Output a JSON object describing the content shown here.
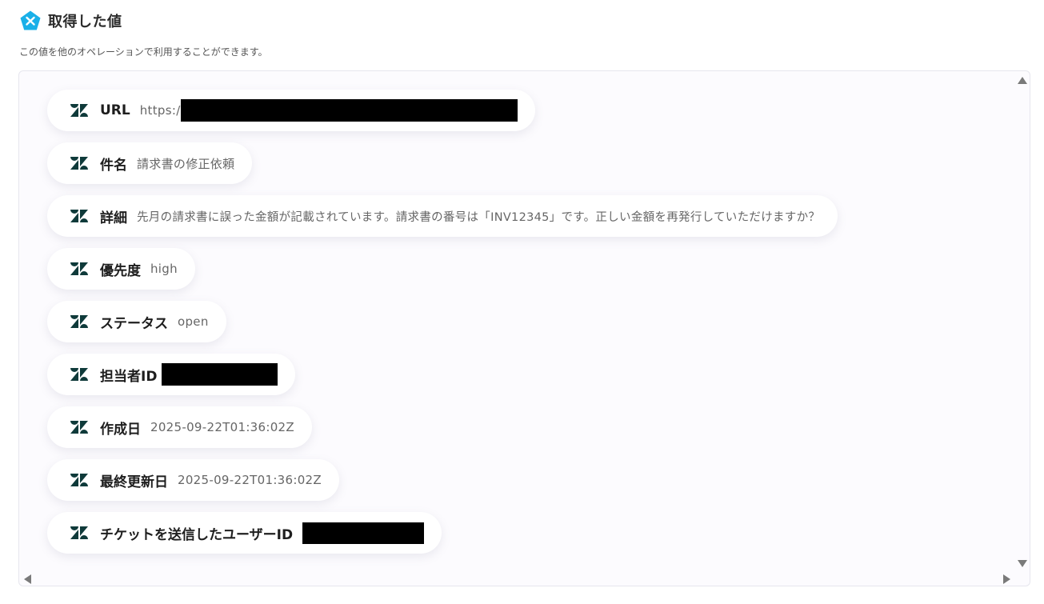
{
  "header": {
    "title": "取得した値",
    "subtitle": "この値を他のオペレーションで利用することができます。",
    "logo_icon": "yoom-pentagon-x-icon",
    "accent": "#1ab0e8"
  },
  "rows": [
    {
      "label": "URL",
      "value": "https:/",
      "redacted": true,
      "icon": "zendesk-icon"
    },
    {
      "label": "件名",
      "value": "請求書の修正依頼",
      "redacted": false,
      "icon": "zendesk-icon"
    },
    {
      "label": "詳細",
      "value": "先月の請求書に誤った金額が記載されています。請求書の番号は「INV12345」です。正しい金額を再発行していただけますか？",
      "redacted": false,
      "icon": "zendesk-icon"
    },
    {
      "label": "優先度",
      "value": "high",
      "redacted": false,
      "icon": "zendesk-icon"
    },
    {
      "label": "ステータス",
      "value": "open",
      "redacted": false,
      "icon": "zendesk-icon"
    },
    {
      "label": "担当者ID",
      "value": "",
      "redacted": true,
      "icon": "zendesk-icon"
    },
    {
      "label": "作成日",
      "value": "2025-09-22T01:36:02Z",
      "redacted": false,
      "icon": "zendesk-icon"
    },
    {
      "label": "最終更新日",
      "value": "2025-09-22T01:36:02Z",
      "redacted": false,
      "icon": "zendesk-icon"
    },
    {
      "label": "チケットを送信したユーザーID",
      "value": "",
      "redacted": true,
      "icon": "zendesk-icon"
    }
  ],
  "icon_color": "#0f3a3a"
}
